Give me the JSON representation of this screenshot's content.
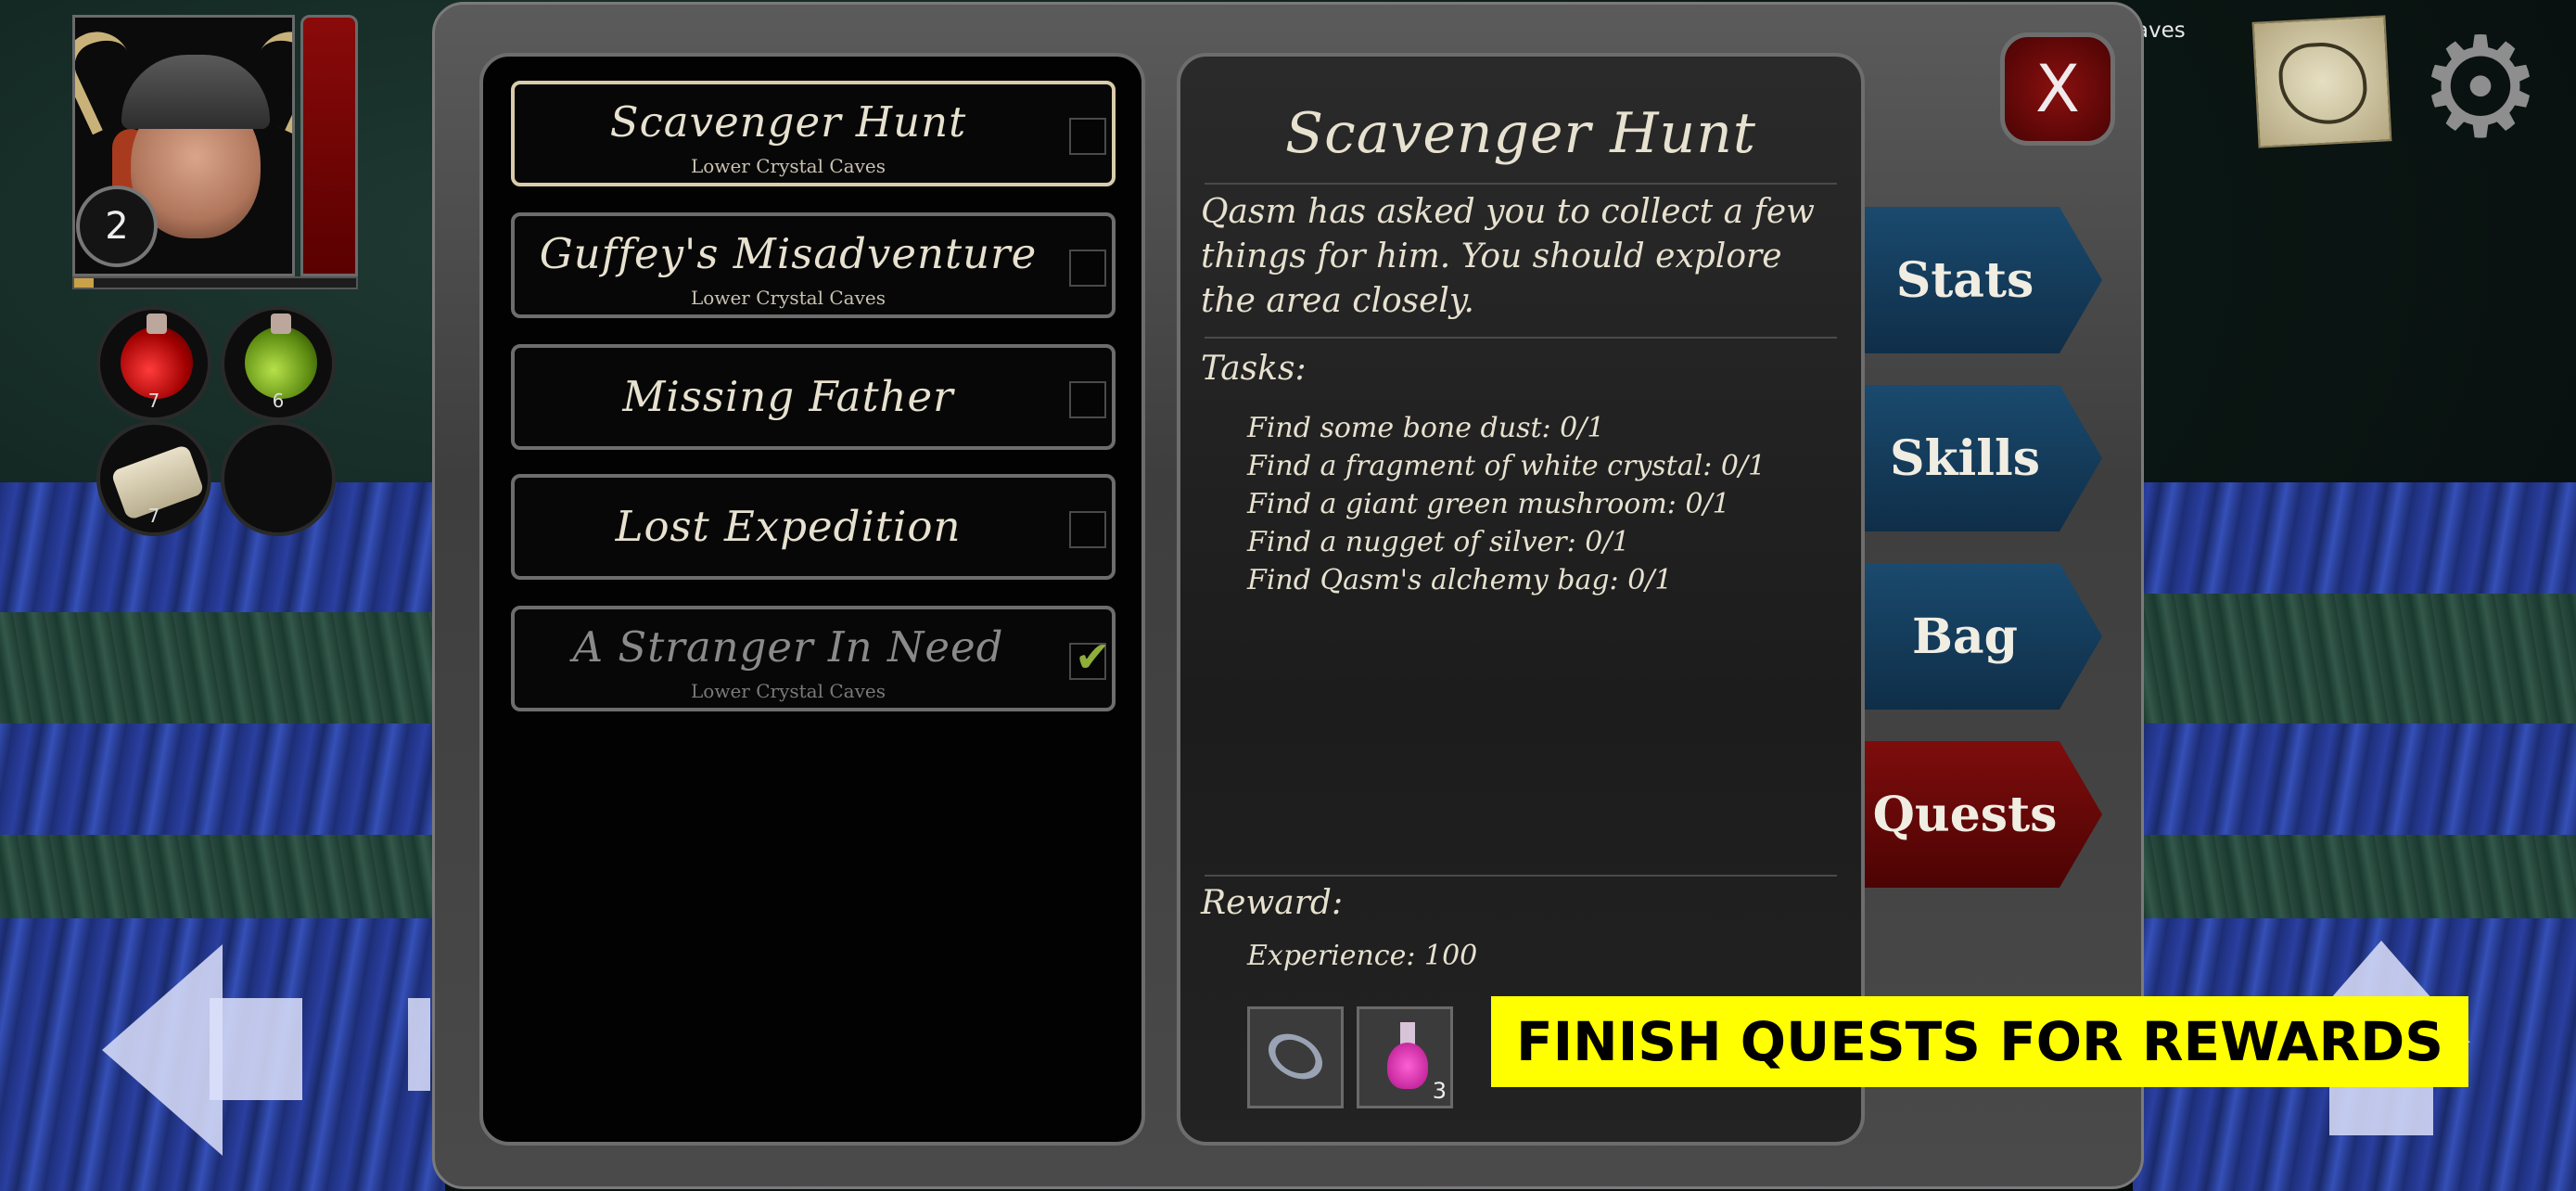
{
  "hud": {
    "player_level": "2",
    "xp_progress": 0.07,
    "quick_slots": [
      {
        "icon": "health-potion-icon",
        "count": "7"
      },
      {
        "icon": "stamina-potion-icon",
        "count": "6"
      },
      {
        "icon": "scroll-icon",
        "count": "7"
      },
      {
        "icon": "empty-slot",
        "count": ""
      }
    ],
    "location_label": "tal Caves"
  },
  "quest_list": [
    {
      "title": "Scavenger Hunt",
      "subtitle": "Lower Crystal Caves",
      "selected": true,
      "completed": false
    },
    {
      "title": "Guffey's Misadventure",
      "subtitle": "Lower Crystal Caves",
      "selected": false,
      "completed": false
    },
    {
      "title": "Missing Father",
      "subtitle": "",
      "selected": false,
      "completed": false
    },
    {
      "title": "Lost Expedition",
      "subtitle": "",
      "selected": false,
      "completed": false
    },
    {
      "title": "A Stranger In Need",
      "subtitle": "Lower Crystal Caves",
      "selected": false,
      "completed": true
    }
  ],
  "detail": {
    "title": "Scavenger Hunt",
    "description": "Qasm has asked you to collect a few things for him. You should explore the area closely.",
    "tasks_heading": "Tasks:",
    "tasks": [
      "Find some bone dust: 0/1",
      "Find a fragment of white crystal: 0/1",
      "Find a giant green mushroom: 0/1",
      "Find a nugget of silver: 0/1",
      "Find Qasm's alchemy bag: 0/1"
    ],
    "reward_heading": "Reward:",
    "reward_experience": "Experience: 100",
    "reward_items": [
      {
        "icon": "ring-icon",
        "count": ""
      },
      {
        "icon": "pink-potion-icon",
        "count": "3"
      }
    ]
  },
  "close_label": "X",
  "tabs": [
    {
      "label": "Stats",
      "active": false
    },
    {
      "label": "Skills",
      "active": false
    },
    {
      "label": "Bag",
      "active": false
    },
    {
      "label": "Quests",
      "active": true
    }
  ],
  "promo_banner": "FINISH QUESTS FOR REWARDS",
  "colors": {
    "tab_blue": "#1a4a6e",
    "tab_active_red": "#7e0d0d",
    "banner_yellow": "#ffff00",
    "parchment_text": "#e7e1cf"
  }
}
